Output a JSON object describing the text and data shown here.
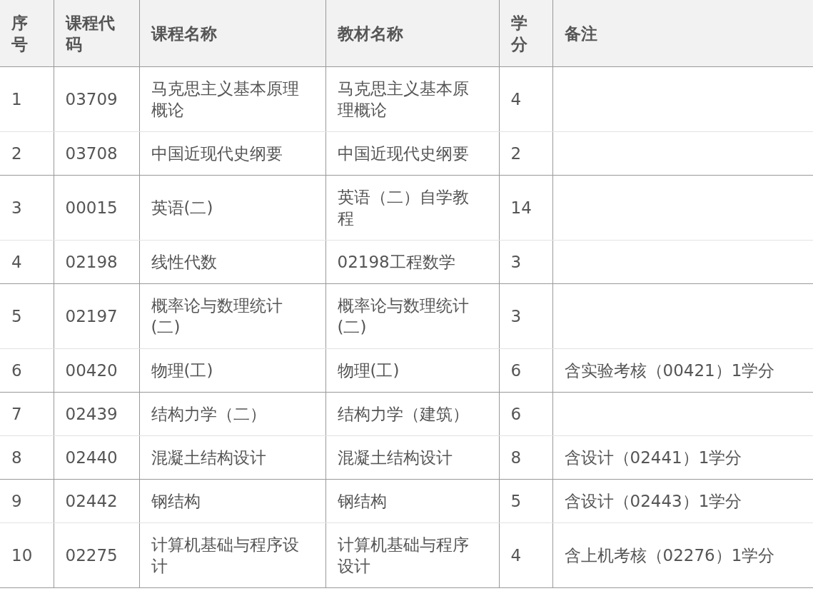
{
  "table": {
    "columns": [
      "序号",
      "课程代码",
      "课程名称",
      "教材名称",
      "学分",
      "备注"
    ],
    "rows": [
      [
        "1",
        "03709",
        "马克思主义基本原理概论",
        "马克思主义基本原理概论",
        "4",
        ""
      ],
      [
        "2",
        "03708",
        "中国近现代史纲要",
        "中国近现代史纲要",
        "2",
        ""
      ],
      [
        "3",
        "00015",
        "英语(二)",
        "英语（二）自学教程",
        "14",
        ""
      ],
      [
        "4",
        "02198",
        "线性代数",
        "02198工程数学",
        "3",
        ""
      ],
      [
        "5",
        "02197",
        "概率论与数理统计(二)",
        "概率论与数理统计(二)",
        "3",
        ""
      ],
      [
        "6",
        "00420",
        "物理(工)",
        "物理(工)",
        "6",
        "含实验考核（00421）1学分"
      ],
      [
        "7",
        "02439",
        "结构力学（二）",
        "结构力学（建筑）",
        "6",
        ""
      ],
      [
        "8",
        "02440",
        "混凝土结构设计",
        "混凝土结构设计",
        "8",
        "含设计（02441）1学分"
      ],
      [
        "9",
        "02442",
        "钢结构",
        "钢结构",
        "5",
        "含设计（02443）1学分"
      ],
      [
        "10",
        "02275",
        "计算机基础与程序设计",
        "计算机基础与程序设计",
        "4",
        "含上机考核（02276）1学分"
      ]
    ]
  }
}
